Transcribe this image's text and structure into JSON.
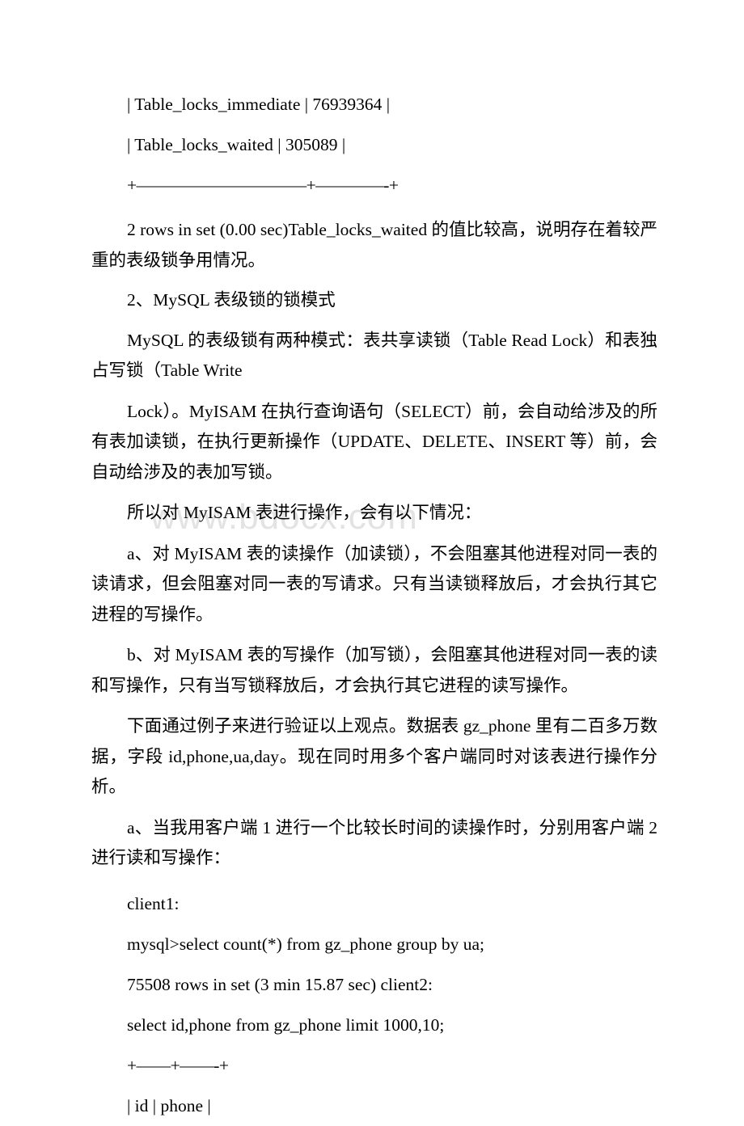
{
  "document": {
    "watermark": "www.bdocx.com",
    "blocks": [
      {
        "id": "row-immediate",
        "text": "| Table_locks_immediate | 76939364 |"
      },
      {
        "id": "row-waited",
        "text": "| Table_locks_waited | 305089 |"
      },
      {
        "id": "table-separator-1",
        "text": "+——————————+————-+"
      },
      {
        "id": "para-rows-in-set",
        "text": "2 rows in set (0.00 sec)Table_locks_waited 的值比较高，说明存在着较严重的表级锁争用情况。"
      },
      {
        "id": "heading-2",
        "text": "2、MySQL 表级锁的锁模式"
      },
      {
        "id": "para-lock-modes",
        "text": "MySQL 的表级锁有两种模式：表共享读锁（Table Read Lock）和表独占写锁（Table Write"
      },
      {
        "id": "para-myisam-auto-lock",
        "text": "Lock）。MyISAM 在执行查询语句（SELECT）前，会自动给涉及的所有表加读锁，在执行更新操作（UPDATE、DELETE、INSERT 等）前，会自动给涉及的表加写锁。"
      },
      {
        "id": "para-myisam-cases",
        "text": "所以对 MyISAM 表进行操作，会有以下情况："
      },
      {
        "id": "para-case-a",
        "text": "a、对 MyISAM 表的读操作（加读锁），不会阻塞其他进程对同一表的读请求，但会阻塞对同一表的写请求。只有当读锁释放后，才会执行其它进程的写操作。"
      },
      {
        "id": "para-case-b",
        "text": "b、对 MyISAM 表的写操作（加写锁），会阻塞其他进程对同一表的读和写操作，只有当写锁释放后，才会执行其它进程的读写操作。"
      },
      {
        "id": "para-example-intro",
        "text": "下面通过例子来进行验证以上观点。数据表 gz_phone 里有二百多万数据，字段 id,phone,ua,day。现在同时用多个客户端同时对该表进行操作分析。"
      },
      {
        "id": "para-scenario-a",
        "text": "a、当我用客户端 1 进行一个比较长时间的读操作时，分别用客户端 2 进行读和写操作："
      },
      {
        "id": "line-client1",
        "text": "client1:"
      },
      {
        "id": "line-sql-select-count",
        "text": "mysql>select count(*) from gz_phone group by ua;"
      },
      {
        "id": "line-rows-in-set-client2",
        "text": "75508 rows in set (3 min 15.87 sec) client2:"
      },
      {
        "id": "line-sql-select-id-phone",
        "text": "select id,phone from gz_phone limit 1000,10;"
      },
      {
        "id": "table-separator-2",
        "text": "+——+——-+"
      },
      {
        "id": "row-id-phone-header",
        "text": "| id | phone |"
      }
    ]
  }
}
